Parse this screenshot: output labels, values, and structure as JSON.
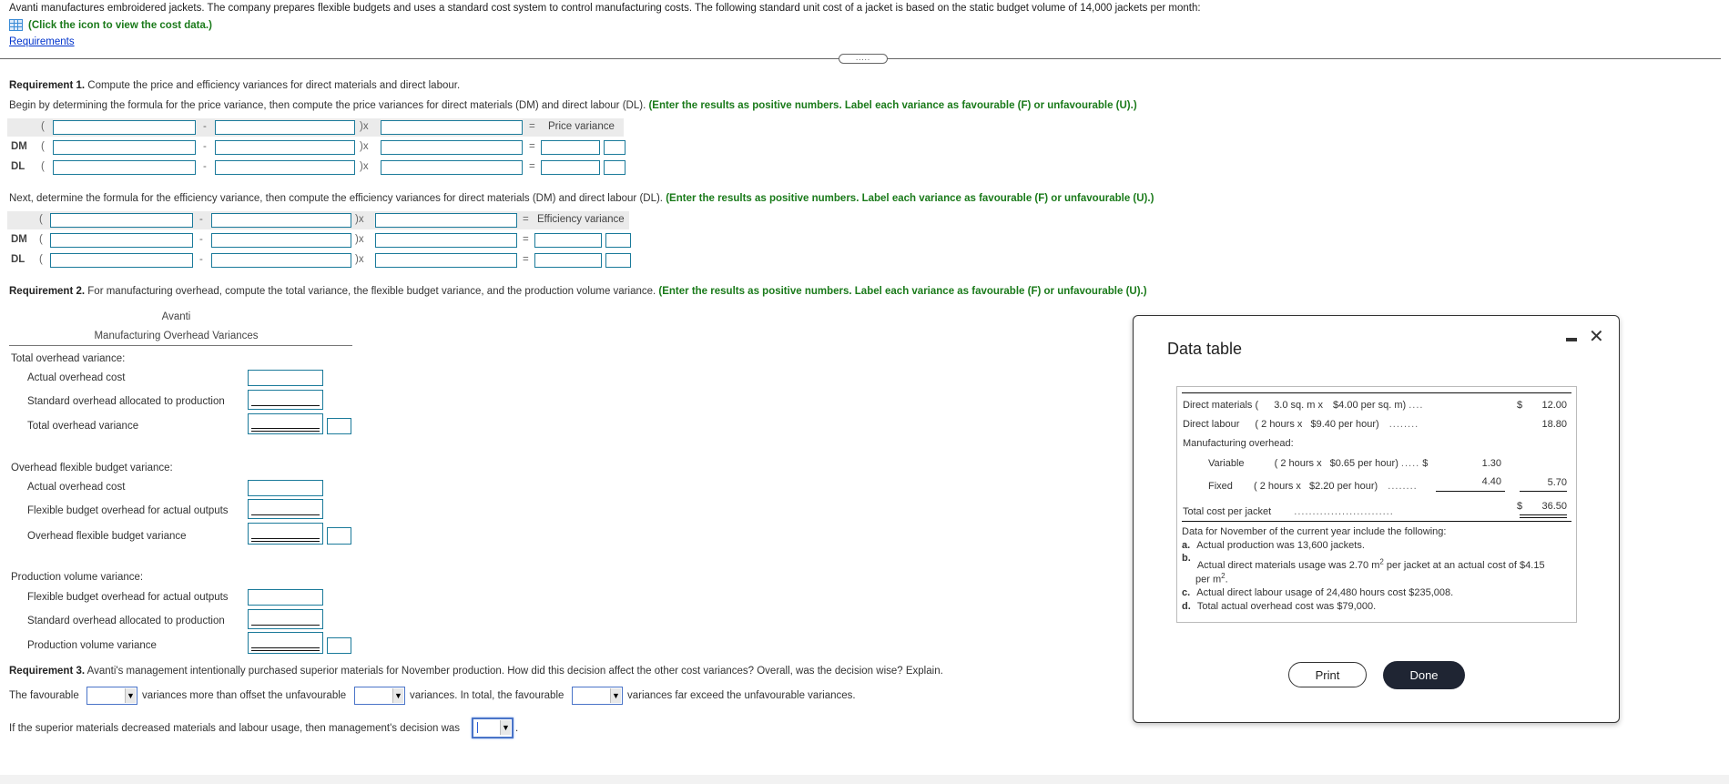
{
  "intro": {
    "text": "Avanti manufactures embroidered jackets. The company prepares flexible budgets and uses a standard cost system to control manufacturing costs. The following standard unit cost of a jacket is based on the static budget volume of 14,000 jackets per month:",
    "cost_data_link": "(Click the icon to view the cost data.)",
    "requirements_link": "Requirements",
    "handle": "....."
  },
  "req1": {
    "heading_bold": "Requirement 1.",
    "heading_text": " Compute the price and efficiency variances for direct materials and direct labour.",
    "price_instruction": "Begin by determining the formula for the price variance, then compute the price variances for direct materials (DM) and direct labour (DL).",
    "price_note": "(Enter the results as positive numbers. Label each variance as favourable (F) or unfavourable (U).)",
    "price_header_result": "Price variance",
    "eff_instruction": "Next, determine the formula for the efficiency variance, then compute the efficiency variances for direct materials (DM) and direct labour (DL).",
    "eff_note": "(Enter the results as positive numbers. Label each variance as favourable (F) or unfavourable (U).)",
    "eff_header_result": "Efficiency variance",
    "row_labels": [
      "DM",
      "DL"
    ],
    "symbols": {
      "open": "(",
      "minus": "-",
      "times": ")x",
      "equals": "="
    }
  },
  "req2": {
    "heading_bold": "Requirement 2.",
    "heading_text": " For manufacturing overhead, compute the total variance, the flexible budget variance, and the production volume variance.",
    "note": "(Enter the results as positive numbers. Label each variance as favourable (F) or unfavourable (U).)",
    "company": "Avanti",
    "table_title": "Manufacturing Overhead Variances",
    "sections": [
      {
        "title": "Total overhead variance:",
        "rows": [
          "Actual overhead cost",
          "Standard overhead allocated to production",
          "Total overhead variance"
        ]
      },
      {
        "title": "Overhead flexible budget variance:",
        "rows": [
          "Actual overhead cost",
          "Flexible budget overhead for actual outputs",
          "Overhead flexible budget variance"
        ]
      },
      {
        "title": "Production volume variance:",
        "rows": [
          "Flexible budget overhead for actual outputs",
          "Standard overhead allocated to production",
          "Production volume variance"
        ]
      }
    ]
  },
  "req3": {
    "heading_bold": "Requirement 3.",
    "heading_text": " Avanti's management intentionally purchased superior materials for November production. How did this decision affect the other cost variances? Overall, was the decision wise? Explain.",
    "s1_a": "The favourable",
    "s1_b": "variances more than offset the unfavourable",
    "s1_c": "variances. In total, the favourable",
    "s1_d": "variances far exceed the unfavourable variances.",
    "s2_a": "If the superior materials decreased materials and labour usage, then management's decision was",
    "s2_end": ".",
    "dropdown_arrow": "▼"
  },
  "modal": {
    "title": "Data table",
    "minimize": "minimize",
    "close": "✕",
    "rows": {
      "dm_label": "Direct materials (",
      "dm_qty": "3.0  sq. m x",
      "dm_rate": "$4.00  per sq. m)",
      "dm_dots": "....",
      "dm_dollar": "$",
      "dm_value": "12.00",
      "dl_label": "Direct labour",
      "dl_qty": "( 2  hours x",
      "dl_rate": "$9.40  per hour)",
      "dl_dots": "........",
      "dl_value": "18.80",
      "moh_label": "Manufacturing overhead:",
      "var_label": "Variable",
      "var_qty": "(  2   hours x",
      "var_rate": "$0.65  per hour)",
      "var_dots": ".....",
      "var_dollar": "$",
      "var_value": "1.30",
      "fix_label": "Fixed",
      "fix_qty": "( 2  hours x",
      "fix_rate": "$2.20  per hour)",
      "fix_dots": "........",
      "fix_value": "4.40",
      "moh_total": "5.70",
      "total_label": "Total cost per jacket",
      "total_dots": "...........................",
      "total_dollar": "$",
      "total_value": "36.50"
    },
    "november_intro": "Data for November of the current year include the following:",
    "november_items": [
      {
        "letter": "a.",
        "text": "Actual production was 13,600 jackets."
      },
      {
        "letter": "b.",
        "text_a": "Actual direct materials usage was 2.70 m",
        "sup": "2",
        "text_b": " per jacket at an actual cost of $4.15",
        "text_c": "per m",
        "sup2": "2",
        "text_d": "."
      },
      {
        "letter": "c.",
        "text": "Actual direct labour usage of 24,480 hours cost $235,008."
      },
      {
        "letter": "d.",
        "text": "Total actual overhead cost was $79,000."
      }
    ],
    "print_label": "Print",
    "done_label": "Done"
  },
  "colors": {
    "green_note": "#1a7a1a",
    "input_border": "#1a7a9a",
    "link_blue": "#0033cc",
    "done_bg": "#1f2533"
  }
}
